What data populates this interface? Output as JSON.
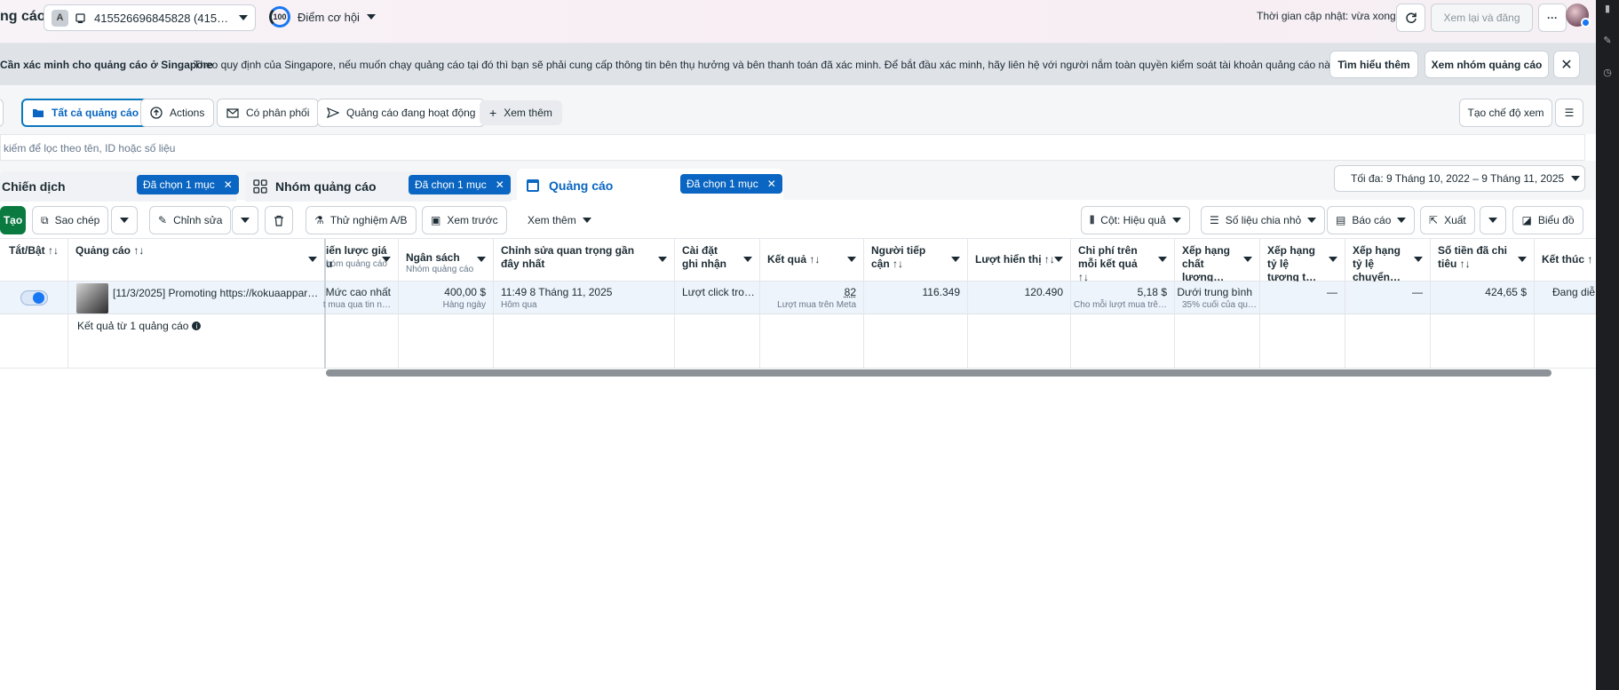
{
  "header": {
    "title": "ng cáo",
    "account_badge": "A",
    "account_id": "415526696845828 (415…",
    "opportunity_score": "100",
    "opportunity_label": "Điểm cơ hội",
    "update_text": "Thời gian cập nhật: vừa xong",
    "review_publish": "Xem lại và đăng"
  },
  "notice": {
    "title": "Cần xác minh cho quảng cáo ở Singapore",
    "text": "Theo quy định của Singapore, nếu muốn chạy quảng cáo tại đó thì bạn sẽ phải cung cấp thông tin bên thụ hưởng và bên thanh toán đã xác minh. Để bắt đầu xác minh, hãy liên hệ với người nắm toàn quyền kiểm soát tài khoản quảng cáo này.",
    "learn_more": "Tìm hiểu thêm",
    "view_adsets": "Xem nhóm quảng cáo"
  },
  "filters": {
    "all_ads": "Tất cả quảng cáo",
    "actions": "Actions",
    "delivered": "Có phân phối",
    "active_ads": "Quảng cáo đang hoạt động",
    "more": "Xem thêm",
    "create_view": "Tạo chế độ xem"
  },
  "search": {
    "placeholder": "kiếm để lọc theo tên, ID hoặc số liệu"
  },
  "level_tabs": {
    "campaign": "Chiến dịch",
    "adset": "Nhóm quảng cáo",
    "ad": "Quảng cáo",
    "selected": "Đã chọn 1 mục",
    "date_range": "Tối đa: 9 Tháng 10, 2022 – 9 Tháng 11, 2025"
  },
  "toolbar": {
    "create": "Tạo",
    "duplicate": "Sao chép",
    "edit": "Chỉnh sửa",
    "ab_test": "Thử nghiệm A/B",
    "preview": "Xem trước",
    "more": "Xem thêm",
    "columns": "Cột: Hiệu quả",
    "breakdown": "Số liệu chia nhỏ",
    "reports": "Báo cáo",
    "export": "Xuất",
    "charts": "Biểu đồ"
  },
  "table": {
    "headers": {
      "toggle": "Tắt/Bật ↑↓",
      "ad": "Quảng cáo ↑↓",
      "bid_strategy_1": "iến lược giá",
      "bid_strategy_2": "u",
      "bid_strategy_sub": "hóm quảng cáo",
      "budget": "Ngân sách",
      "budget_sub": "Nhóm quảng cáo",
      "last_edit": "Chỉnh sửa quan trọng gần đây nhất",
      "attribution": "Cài đặt ghi nhận",
      "results": "Kết quả ↑↓",
      "reach": "Người tiếp cận ↑↓",
      "impressions": "Lượt hiển thị ↑↓",
      "cost_per_result": "Chi phí trên mỗi kết quả ↑↓",
      "quality": "Xếp hạng chất lượng…",
      "engagement_rank": "Xếp hạng tỷ lệ tương t…",
      "conversion_rank": "Xếp hạng tỷ lệ chuyển…",
      "spent": "Số tiền đã chi tiêu ↑↓",
      "ends": "Kết thúc ↑"
    },
    "row": {
      "ad_name": "[11/3/2025] Promoting https://kokuaappar…",
      "bid": "Mức cao nhất",
      "bid_sub": "t mua qua tin n…",
      "budget": "400,00 $",
      "budget_sub": "Hàng ngày",
      "last_edit": "11:49 8 Tháng 11, 2025",
      "last_edit_sub": "Hôm qua",
      "attribution": "Lượt click tro…",
      "results": "82",
      "results_sub": "Lượt mua trên Meta",
      "reach": "116.349",
      "impressions": "120.490",
      "cpr": "5,18 $",
      "cpr_sub": "Cho mỗi lượt mua trê…",
      "quality": "Dưới trung bình",
      "quality_sub": "35% cuối của qu…",
      "engagement": "—",
      "conversion": "—",
      "spent": "424,65 $",
      "ends": "Đang diễ"
    },
    "summary": "Kết quả từ 1 quảng cáo"
  },
  "colors": {
    "accent": "#0a66c2",
    "create": "#0a7a41",
    "notice_bg": "#dfe3e8"
  }
}
